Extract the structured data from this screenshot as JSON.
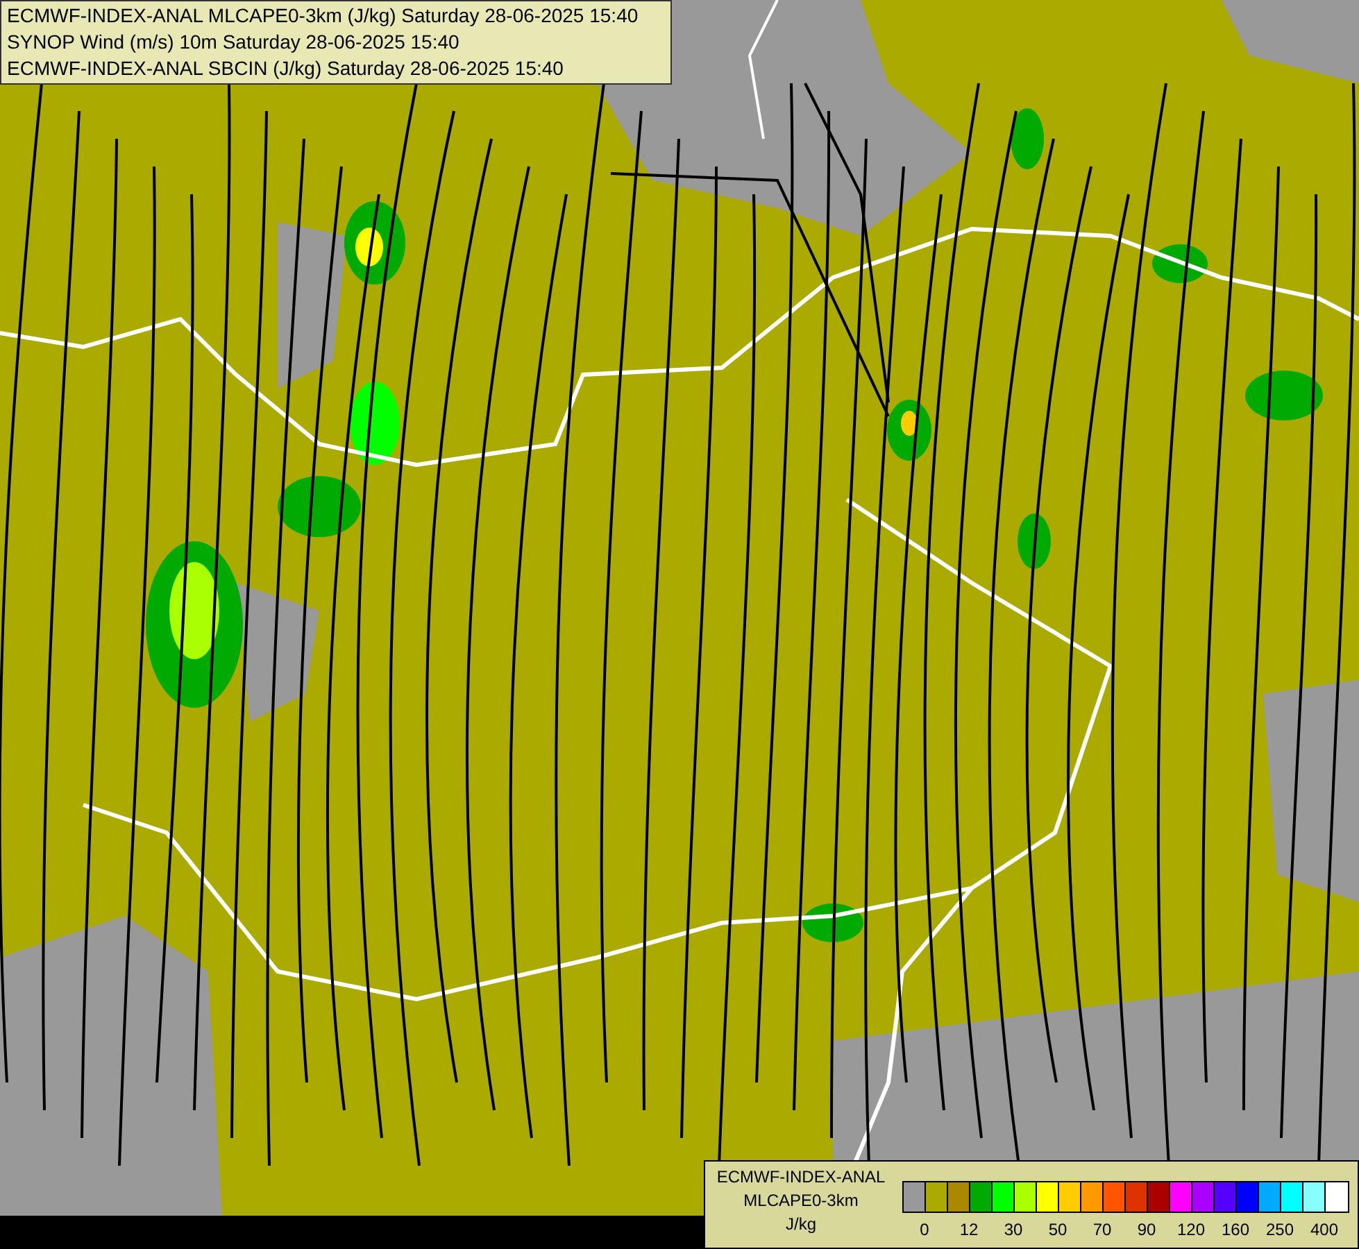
{
  "title_box": {
    "lines": [
      {
        "text": "ECMWF-INDEX-ANAL MLCAPE0-3km (J/kg) Saturday 28-06-2025 15:40"
      },
      {
        "text": "SYNOP Wind (m/s) 10m Saturday 28-06-2025 15:40"
      },
      {
        "text": "ECMWF-INDEX-ANAL SBCIN (J/kg) Saturday 28-06-2025 15:40"
      }
    ]
  },
  "legend": {
    "title_lines": [
      "ECMWF-INDEX-ANAL",
      "MLCAPE0-3km"
    ],
    "unit": "J/kg",
    "swatches": [
      {
        "color": "#999999"
      },
      {
        "color": "#aaaa00"
      },
      {
        "color": "#aa8800"
      },
      {
        "color": "#00aa00"
      },
      {
        "color": "#00ff00"
      },
      {
        "color": "#aaff00"
      },
      {
        "color": "#ffff00"
      },
      {
        "color": "#ffcc00"
      },
      {
        "color": "#ff9900"
      },
      {
        "color": "#ff5500"
      },
      {
        "color": "#dd3300"
      },
      {
        "color": "#aa0000"
      },
      {
        "color": "#ff00ff"
      },
      {
        "color": "#aa00ff"
      },
      {
        "color": "#5500ff"
      },
      {
        "color": "#0000ff"
      },
      {
        "color": "#00aaff"
      },
      {
        "color": "#00ffff"
      },
      {
        "color": "#88ffff"
      },
      {
        "color": "#ffffff"
      }
    ],
    "ticks": [
      "0",
      "12",
      "30",
      "50",
      "70",
      "90",
      "120",
      "160",
      "250",
      "400"
    ]
  }
}
